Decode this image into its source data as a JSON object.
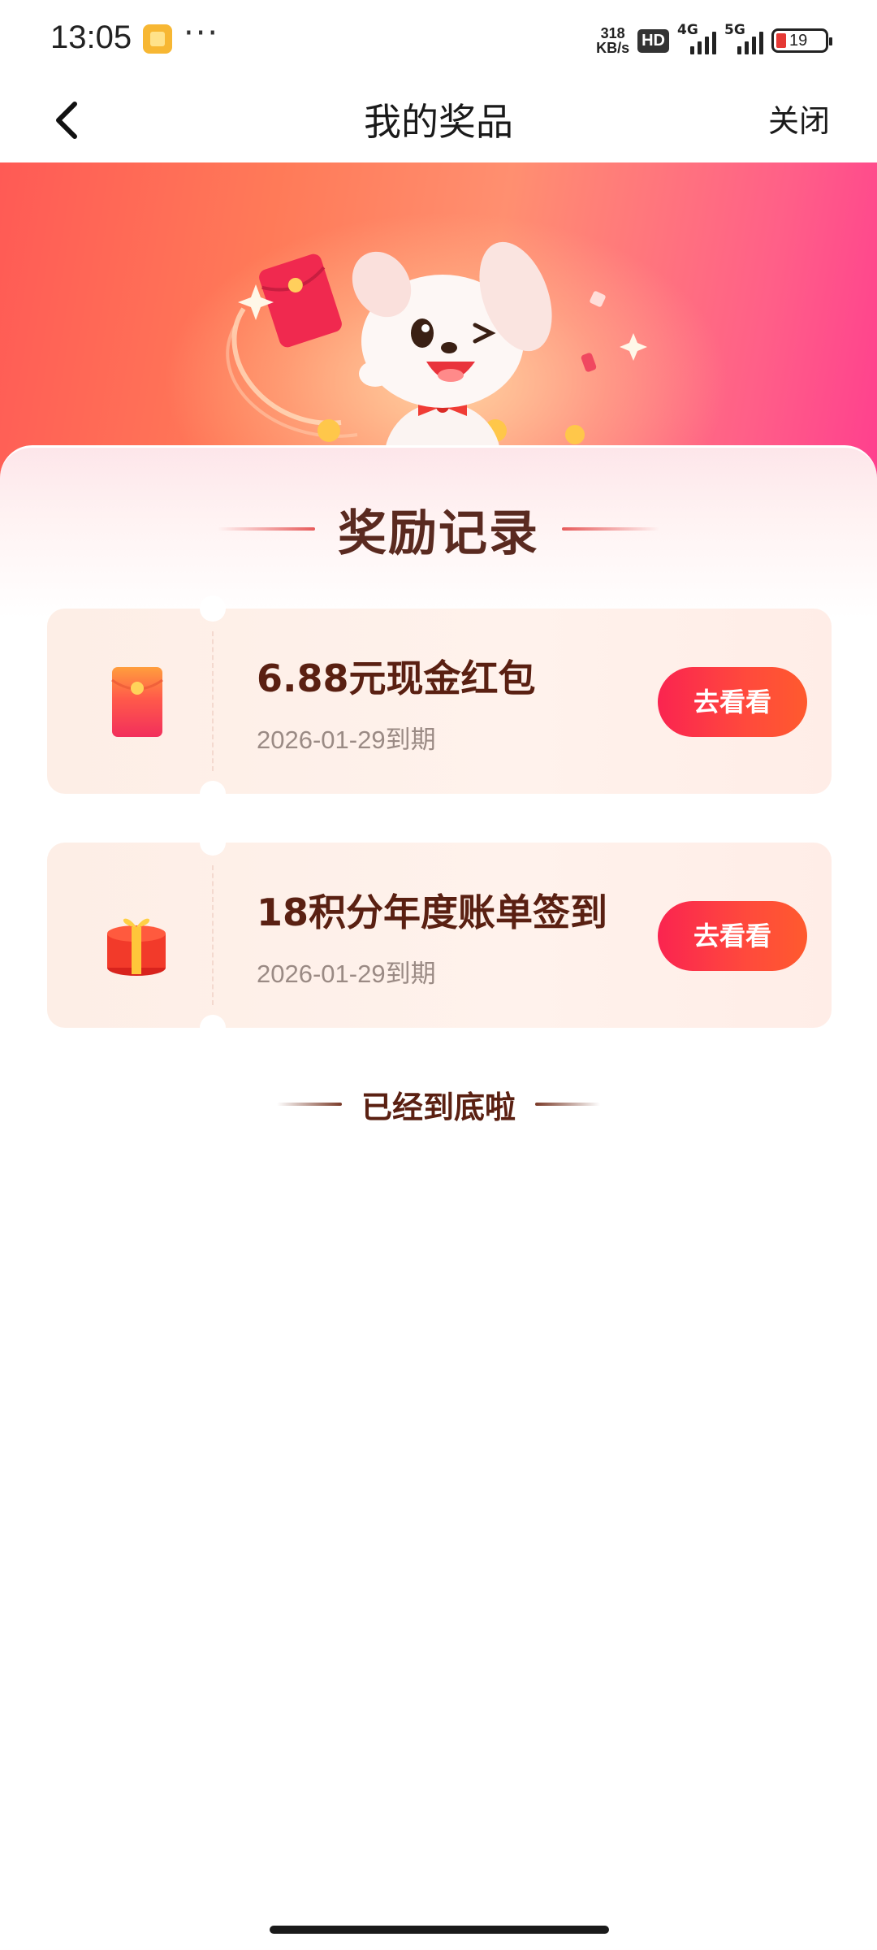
{
  "status_bar": {
    "time": "13:05",
    "more_glyph": "···",
    "net_speed_value": "318",
    "net_speed_unit": "KB/s",
    "hd_label": "HD",
    "signal_1_label": "4G",
    "signal_2_label": "5G",
    "battery_level": "19",
    "battery_color": "#e53935"
  },
  "nav": {
    "back_icon": "chevron-left-icon",
    "title": "我的奖品",
    "close_label": "关闭"
  },
  "banner": {
    "mascot": "puppy-mascot-illustration",
    "colors": {
      "start": "#ff5a55",
      "end": "#ff3f8e"
    }
  },
  "section": {
    "title": "奖励记录"
  },
  "rewards": [
    {
      "icon": "red-envelope-icon",
      "title": "6.88元现金红包",
      "expiry": "2026-01-29到期",
      "button_label": "去看看"
    },
    {
      "icon": "gift-box-icon",
      "title": "18积分年度账单签到",
      "expiry": "2026-01-29到期",
      "button_label": "去看看"
    }
  ],
  "footer": {
    "end_text": "已经到底啦"
  },
  "accent_colors": {
    "button_start": "#fa2450",
    "button_end": "#ff5a2e",
    "title_brown": "#5a2012"
  }
}
